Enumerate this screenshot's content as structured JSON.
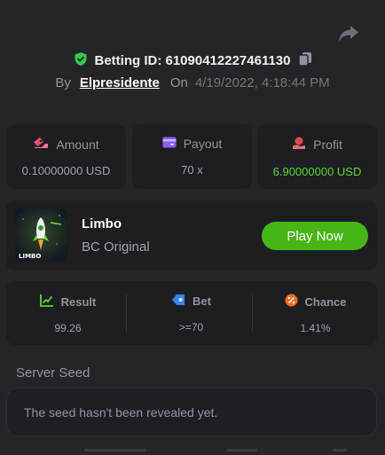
{
  "header": {
    "betting_id_label": "Betting ID:",
    "betting_id": "61090412227461130",
    "by_label": "By",
    "username": "Elpresidente",
    "on_label": "On",
    "timestamp": "4/19/2022, 4:18:44 PM"
  },
  "stats": {
    "amount": {
      "label": "Amount",
      "value": "0.10000000 USD"
    },
    "payout": {
      "label": "Payout",
      "value": "70 x"
    },
    "profit": {
      "label": "Profit",
      "value": "6.90000000 USD"
    }
  },
  "game": {
    "title": "Limbo",
    "subtitle": "BC Original",
    "thumb_text": "LIMBO",
    "play_label": "Play Now"
  },
  "result": {
    "result": {
      "label": "Result",
      "value": "99.26"
    },
    "bet": {
      "label": "Bet",
      "value": ">=70"
    },
    "chance": {
      "label": "Chance",
      "value": "1.41%"
    }
  },
  "seed": {
    "label": "Server Seed",
    "text": "The seed hasn't been revealed yet."
  },
  "colors": {
    "background": "#232529",
    "card": "#1c1e22",
    "accent_green": "#48b517",
    "profit_green": "#5fd52f"
  },
  "icons": [
    "share-icon",
    "shield-check-icon",
    "copy-icon",
    "amount-icon",
    "payout-icon",
    "profit-icon",
    "result-icon",
    "bet-icon",
    "chance-icon"
  ]
}
